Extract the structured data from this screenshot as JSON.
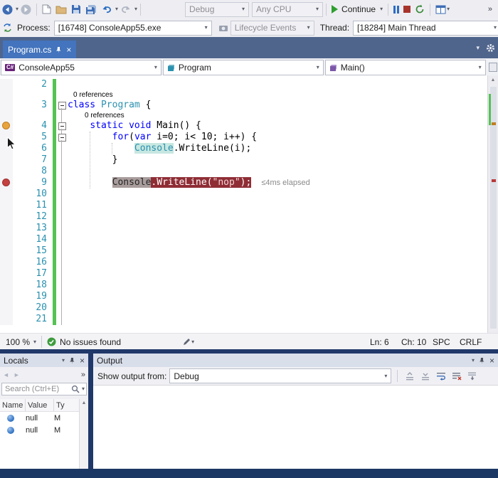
{
  "glyphs": {
    "caret": "▾",
    "overflow": "»",
    "up_arrow": "▲",
    "close": "×",
    "left_arrow": "◄",
    "right_arrow": "►",
    "csharp_badge": "C#"
  },
  "toolbar": {
    "config": "Debug",
    "platform": "Any CPU",
    "continue_label": "Continue"
  },
  "debug_location_bar": {
    "process_label": "Process:",
    "process_value": "[16748] ConsoleApp55.exe",
    "lifecycle_value": "Lifecycle Events",
    "thread_label": "Thread:",
    "thread_value": "[18284] Main Thread"
  },
  "document_tab": {
    "title": "Program.cs"
  },
  "navigation_bar": {
    "project": "ConsoleApp55",
    "type": "Program",
    "member": "Main()"
  },
  "editor": {
    "codelens_label": "0 references",
    "perf_tip": "≤4ms elapsed",
    "lines": [
      {
        "num": "2",
        "tokens": []
      },
      {
        "num": "3",
        "lens": 0,
        "lens_fold": "",
        "fold": "box",
        "tokens": [
          [
            "class",
            "kw"
          ],
          [
            " "
          ],
          [
            "Program",
            "type"
          ],
          [
            " {"
          ]
        ]
      },
      {
        "num": "4",
        "lens": 4,
        "lens_fold": "line",
        "fold": "box",
        "fold_head": true,
        "bp": "orange",
        "tokens": [
          [
            "    "
          ],
          [
            "static",
            "kw"
          ],
          [
            " "
          ],
          [
            "void",
            "kw"
          ],
          [
            " "
          ],
          [
            "Main"
          ],
          [
            "() {"
          ]
        ]
      },
      {
        "num": "5",
        "fold": "box",
        "fold_head": true,
        "tokens": [
          [
            "        "
          ],
          [
            "for",
            "kw"
          ],
          [
            "("
          ],
          [
            "var",
            "kw"
          ],
          [
            " i=0; i< 10; i++) {"
          ]
        ]
      },
      {
        "num": "6",
        "fold": "line",
        "tokens": [
          [
            "            "
          ],
          [
            "Console",
            "type hl"
          ],
          [
            ".WriteLine(i);"
          ]
        ]
      },
      {
        "num": "7",
        "fold": "line",
        "tokens": [
          [
            "        }"
          ]
        ]
      },
      {
        "num": "8",
        "fold": "line",
        "tokens": []
      },
      {
        "num": "9",
        "fold": "line",
        "bp": "red",
        "tip": true,
        "tokens": [
          [
            "        "
          ],
          [
            "Console",
            "bpc"
          ],
          [
            ".WriteLine(",
            "bp"
          ],
          [
            "\"nop\"",
            "bps"
          ],
          [
            ");",
            "bp"
          ]
        ]
      },
      {
        "num": "10",
        "fold": "line",
        "tokens": []
      },
      {
        "num": "11",
        "fold": "line",
        "tokens": []
      },
      {
        "num": "12",
        "fold": "line",
        "tokens": []
      },
      {
        "num": "13",
        "fold": "line",
        "tokens": []
      },
      {
        "num": "14",
        "fold": "line",
        "tokens": []
      },
      {
        "num": "15",
        "fold": "line",
        "tokens": []
      },
      {
        "num": "16",
        "fold": "line",
        "tokens": []
      },
      {
        "num": "17",
        "fold": "line",
        "tokens": []
      },
      {
        "num": "18",
        "fold": "line",
        "tokens": []
      },
      {
        "num": "19",
        "fold": "line",
        "tokens": []
      },
      {
        "num": "20",
        "fold": "line",
        "tokens": []
      },
      {
        "num": "21",
        "fold": "line",
        "tokens": []
      }
    ]
  },
  "editor_status_bar": {
    "zoom": "100 %",
    "health": "No issues found",
    "line": "Ln: 6",
    "column": "Ch: 10",
    "insert_mode": "SPC",
    "line_ending": "CRLF"
  },
  "locals_panel": {
    "title": "Locals",
    "search_placeholder": "Search (Ctrl+E)",
    "columns": [
      "Name",
      "Value",
      "Ty"
    ],
    "rows": [
      {
        "value": "null",
        "type": "M"
      },
      {
        "value": "null",
        "type": "M"
      }
    ]
  },
  "output_panel": {
    "title": "Output",
    "source_label": "Show output from:",
    "source_value": "Debug"
  }
}
